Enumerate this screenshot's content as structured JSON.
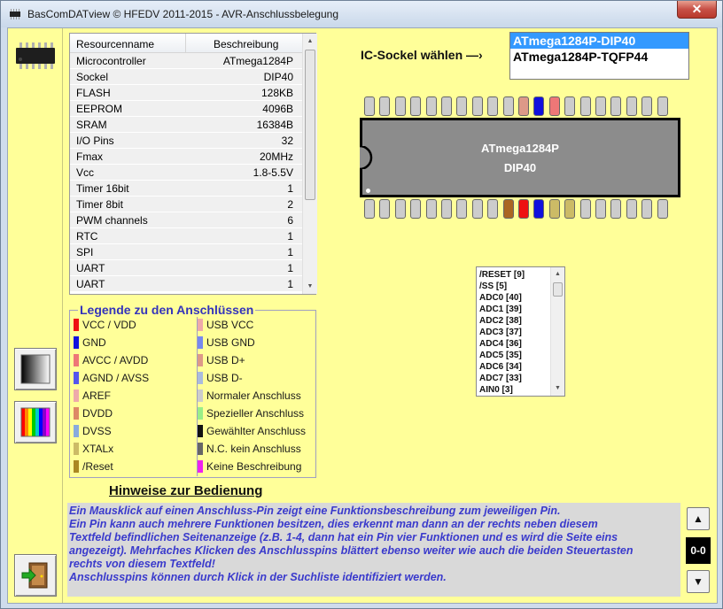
{
  "window": {
    "title": "BasComDATview © HFEDV 2011-2015 - AVR-Anschlussbelegung",
    "close_label": "✕"
  },
  "resources": {
    "headers": [
      "Resourcenname",
      "Beschreibung"
    ],
    "rows": [
      [
        "Microcontroller",
        "ATmega1284P"
      ],
      [
        "Sockel",
        "DIP40"
      ],
      [
        "FLASH",
        "128KB"
      ],
      [
        "EEPROM",
        "4096B"
      ],
      [
        "SRAM",
        "16384B"
      ],
      [
        "I/O Pins",
        "32"
      ],
      [
        "Fmax",
        "20MHz"
      ],
      [
        "Vcc",
        "1.8-5.5V"
      ],
      [
        "Timer 16bit",
        "1"
      ],
      [
        "Timer 8bit",
        "2"
      ],
      [
        "PWM channels",
        "6"
      ],
      [
        "RTC",
        "1"
      ],
      [
        "SPI",
        "1"
      ],
      [
        "UART",
        "1"
      ],
      [
        "UART",
        "1"
      ]
    ]
  },
  "legend": {
    "title": "Legende zu den Anschlüssen",
    "left": [
      {
        "label": "VCC / VDD",
        "color": "#ee1111"
      },
      {
        "label": "GND",
        "color": "#1111dd"
      },
      {
        "label": "AVCC / AVDD",
        "color": "#ee7777"
      },
      {
        "label": "AGND / AVSS",
        "color": "#5555ee"
      },
      {
        "label": "AREF",
        "color": "#eeaaaa"
      },
      {
        "label": "DVDD",
        "color": "#dd8866"
      },
      {
        "label": "DVSS",
        "color": "#88aadd"
      },
      {
        "label": "XTALx",
        "color": "#ccbb66"
      },
      {
        "label": "/Reset",
        "color": "#aa8822"
      }
    ],
    "right": [
      {
        "label": "USB VCC",
        "color": "#eeaaaa"
      },
      {
        "label": "USB GND",
        "color": "#7788ee"
      },
      {
        "label": "USB D+",
        "color": "#dd9988"
      },
      {
        "label": "USB D-",
        "color": "#aabbdd"
      },
      {
        "label": "Normaler Anschluss",
        "color": "#cccccc"
      },
      {
        "label": "Spezieller Anschluss",
        "color": "#99ee88"
      },
      {
        "label": "Gewählter Anschluss",
        "color": "#111111"
      },
      {
        "label": "N.C. kein Anschluss",
        "color": "#666666"
      },
      {
        "label": "Keine Beschreibung",
        "color": "#ee22ee"
      }
    ]
  },
  "socket": {
    "label": "IC-Sockel wählen —›",
    "options": [
      "ATmega1284P-DIP40",
      "ATmega1284P-TQFP44"
    ],
    "selected": 0
  },
  "ic": {
    "name": "ATmega1284P",
    "package": "DIP40",
    "top_pin_colors": [
      "#cccccc",
      "#cccccc",
      "#cccccc",
      "#cccccc",
      "#cccccc",
      "#cccccc",
      "#cccccc",
      "#cccccc",
      "#cccccc",
      "#cccccc",
      "#dd9988",
      "#1111dd",
      "#ee7777",
      "#cccccc",
      "#cccccc",
      "#cccccc",
      "#cccccc",
      "#cccccc",
      "#cccccc",
      "#cccccc"
    ],
    "bottom_pin_colors": [
      "#cccccc",
      "#cccccc",
      "#cccccc",
      "#cccccc",
      "#cccccc",
      "#cccccc",
      "#cccccc",
      "#cccccc",
      "#cccccc",
      "#aa6622",
      "#ee1111",
      "#1111dd",
      "#ccbb66",
      "#ccbb66",
      "#cccccc",
      "#cccccc",
      "#cccccc",
      "#cccccc",
      "#cccccc",
      "#cccccc"
    ]
  },
  "search_list": {
    "items": [
      "/RESET [9]",
      "/SS [5]",
      "ADC0 [40]",
      "ADC1 [39]",
      "ADC2 [38]",
      "ADC3 [37]",
      "ADC4 [36]",
      "ADC5 [35]",
      "ADC6 [34]",
      "ADC7 [33]",
      "AIN0 [3]"
    ]
  },
  "hints": {
    "title": "Hinweise zur Bedienung",
    "lines": [
      "Ein Mausklick auf einen Anschluss-Pin zeigt eine Funktionsbeschreibung zum jeweiligen Pin.",
      "Ein Pin kann auch mehrere Funktionen besitzen, dies erkennt man dann an der rechts neben diesem",
      "Textfeld befindlichen Seitenanzeige (z.B. 1-4, dann hat ein Pin vier Funktionen und es wird die Seite eins",
      "angezeigt). Mehrfaches Klicken des Anschlusspins blättert ebenso weiter wie auch die beiden Steuertasten",
      "rechts von diesem Textfeld!",
      "Anschlusspins können durch Klick in der Suchliste identifiziert werden."
    ],
    "page": "0-0",
    "up_label": "▲",
    "down_label": "▼"
  }
}
